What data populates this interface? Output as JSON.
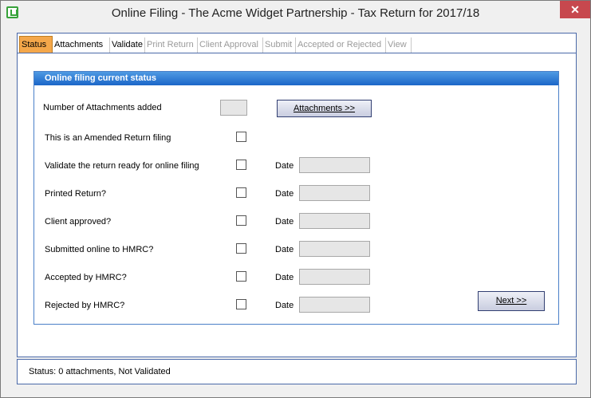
{
  "window": {
    "title": "Online Filing - The Acme Widget Partnership - Tax Return for 2017/18",
    "close_label": "✕"
  },
  "tabs": [
    {
      "label": "Status",
      "state": "active"
    },
    {
      "label": "Attachments",
      "state": "enabled"
    },
    {
      "label": "Validate",
      "state": "enabled"
    },
    {
      "label": "Print Return",
      "state": "disabled"
    },
    {
      "label": "Client Approval",
      "state": "disabled"
    },
    {
      "label": "Submit",
      "state": "disabled"
    },
    {
      "label": "Accepted or Rejected",
      "state": "disabled"
    },
    {
      "label": "View",
      "state": "disabled"
    }
  ],
  "group": {
    "header": "Online filing current status"
  },
  "attachments": {
    "label": "Number of Attachments added",
    "count_value": "",
    "button_label": "Attachments >>"
  },
  "rows": [
    {
      "label": "This is an Amended Return filing",
      "checked": false,
      "has_date": false
    },
    {
      "label": "Validate the return ready for online filing",
      "checked": false,
      "has_date": true,
      "date_label": "Date",
      "date_value": ""
    },
    {
      "label": "Printed Return?",
      "checked": false,
      "has_date": true,
      "date_label": "Date",
      "date_value": ""
    },
    {
      "label": "Client approved?",
      "checked": false,
      "has_date": true,
      "date_label": "Date",
      "date_value": ""
    },
    {
      "label": "Submitted online to HMRC?",
      "checked": false,
      "has_date": true,
      "date_label": "Date",
      "date_value": ""
    },
    {
      "label": "Accepted by HMRC?",
      "checked": false,
      "has_date": true,
      "date_label": "Date",
      "date_value": ""
    },
    {
      "label": "Rejected by HMRC?",
      "checked": false,
      "has_date": true,
      "date_label": "Date",
      "date_value": ""
    }
  ],
  "next_button": {
    "label": "Next >>"
  },
  "status": {
    "text": "Status: 0 attachments, Not Validated"
  },
  "colors": {
    "active_tab": "#f4a74a",
    "group_header": "#1b66c8",
    "close_button": "#c7484e"
  },
  "icons": {
    "app": "app-logo-icon",
    "close": "close-icon"
  }
}
